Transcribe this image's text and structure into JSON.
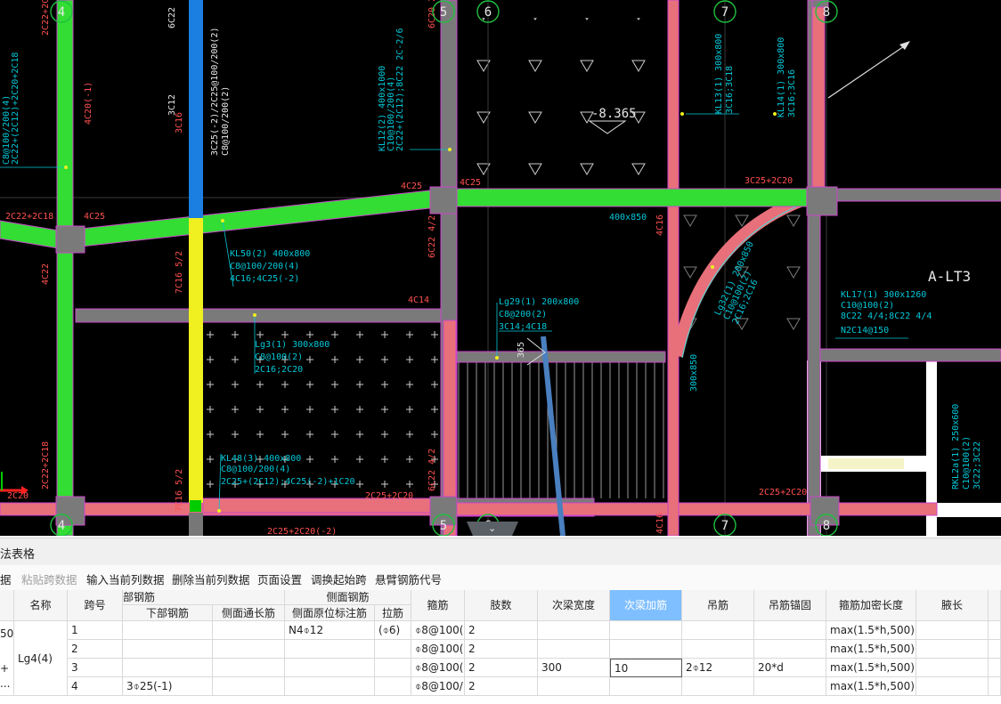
{
  "drawing": {
    "axis_labels": {
      "a4": "4",
      "a5": "5",
      "a6": "6",
      "a7": "7",
      "a8": "8"
    },
    "elevation": "-8.365",
    "region_label": "A-LT3",
    "ann": {
      "t_2c22_top": "2C22+2C18",
      "t_4c20": "4C20(-1)",
      "t_2c22_20": "2C22+(2C12)+2C20+2C18",
      "t_c8_200": "C8@100/200(4)",
      "t_3c12": "3C12",
      "t_3c16": "3C16",
      "t_6c22": "6C22",
      "t_3c25": "3C25(-2)/2C25@100/200(2)",
      "t_c8_200b": "C8@100/200(2)",
      "t_kl12": "KL12(2) 400x1000",
      "t_kl12b": "C10@100/200(4)",
      "t_kl12c": "2C22+(2C12);8C22 2C-2/6",
      "t_6c20": "6C20 2/4",
      "t_kl13": "KL13(1) 300x800",
      "t_kl13b": "3C16;3C18",
      "t_kl14": "KL14(1) 300x800",
      "t_kl14b": "3C16;3C16",
      "t_4c25a": "4C25",
      "t_4c25b": "4C25",
      "t_3c25_2c20": "3C25+2C20",
      "t_2c22_18": "2C22+2C18",
      "t_4c25c": "4C25",
      "t_400x850": "400x850",
      "t_4c16": "4C16",
      "t_4c22": "4C22",
      "t_kl50": "KL50(2) 400x800",
      "t_kl50b": "C8@100/200(4)",
      "t_kl50c": "4C16;4C25(-2)",
      "t_7c16": "7C16 5/2",
      "t_6c22_42": "6C22 4/2",
      "t_4c14": "4C14",
      "t_lg29": "Lg29(1) 200x800",
      "t_lg29b": "C8@200(2)",
      "t_lg29c": "3C14;4C18",
      "t_lg32": "Lg32(1) 200x850",
      "t_lg32b": "C10@100(2)",
      "t_lg32c": "2C16;2C16",
      "t_kl17": "KL17(1) 300x1260",
      "t_kl17b": "C10@100(2)",
      "t_kl17c": "8C22 4/4;8C22 4/4",
      "t_kl17d": "N2C14@150",
      "t_lg3": "Lg3(1) 300x800",
      "t_lg3b": "C8@100(2)",
      "t_lg3c": "2C16;2C20",
      "t_300x850": "300x850",
      "t_2c22_18b": "2C22+2C18",
      "t_kl48": "KL48(3) 400x800",
      "t_kl48b": "C8@100/200(4)",
      "t_kl48c": "2C25+(2C12);4C25(-2)+1C20",
      "t_7c16b": "7C16 5/2",
      "t_6c22_42b": "6C22 4/2",
      "t_2c25_2c20": "2C25+2C20",
      "t_2c25_2c20b": "2C25+2C20",
      "t_2c25_2c20k": "2C25+2C20(-2)",
      "t_2c20": "2C20",
      "t_rkl2": "RKL2a(1) 250x600",
      "t_rkl2b": "C10@100(2)",
      "t_rkl2c": "3C22;3C22",
      "t_365": "365",
      "t_4c16b": "4C16"
    }
  },
  "panel": {
    "title": "法表格",
    "collapse_icon": "⌄",
    "toolbar": {
      "paste_label": "据",
      "paste_span_label": "粘贴跨数据",
      "input_col_label": "输入当前列数据",
      "delete_col_label": "删除当前列数据",
      "page_setup_label": "页面设置",
      "swap_start_label": "调换起始跨",
      "cantilever_label": "悬臂钢筋代号"
    },
    "table": {
      "header": {
        "name": "名称",
        "span": "跨号",
        "bottom_group": "部钢筋",
        "bottom_bar": "下部钢筋",
        "side_group": "侧面钢筋",
        "side_through": "侧面通长筋",
        "side_orig": "侧面原位标注筋",
        "tie": "拉筋",
        "stirrup": "箍筋",
        "legs": "肢数",
        "sec_width": "次梁宽度",
        "sec_add": "次梁加筋",
        "hanger": "吊筋",
        "hanger_anchor": "吊筋锚固",
        "dense_len": "箍筋加密长度",
        "haunch_len": "腋长"
      },
      "left_fragments": {
        "f1": "50",
        "f2": "+",
        "f3": "..."
      },
      "beam_name": "Lg4(4)",
      "rows": [
        {
          "span": "1",
          "bottom": "",
          "side_through": "",
          "side_orig": "N4⌽12",
          "tie": "(⌽6)",
          "stirrup": "⌽8@100(",
          "legs": "2",
          "sec_width": "",
          "sec_add": "",
          "hanger": "",
          "anchor": "",
          "dense": "max(1.5*h,500)",
          "haunch": ""
        },
        {
          "span": "2",
          "bottom": "",
          "side_through": "",
          "side_orig": "",
          "tie": "",
          "stirrup": "⌽8@100(",
          "legs": "2",
          "sec_width": "",
          "sec_add": "",
          "hanger": "",
          "anchor": "",
          "dense": "max(1.5*h,500)",
          "haunch": ""
        },
        {
          "span": "3",
          "bottom": "",
          "side_through": "",
          "side_orig": "",
          "tie": "",
          "stirrup": "⌽8@100(",
          "legs": "2",
          "sec_width": "300",
          "sec_add": "10",
          "hanger": "2⌽12",
          "anchor": "20*d",
          "dense": "max(1.5*h,500)",
          "haunch": ""
        },
        {
          "span": "4",
          "bottom": "3⌽25(-1)",
          "side_through": "",
          "side_orig": "",
          "tie": "",
          "stirrup": "⌽8@100/",
          "legs": "2",
          "sec_width": "",
          "sec_add": "",
          "hanger": "",
          "anchor": "",
          "dense": "max(1.5*h,500)",
          "haunch": ""
        }
      ]
    }
  },
  "colors": {
    "green_beam": "#33dd33",
    "pink_beam": "#e8707a",
    "gray_beam": "#7a7a7a",
    "blue_col": "#1a7fe0",
    "yellow_col": "#f0f020",
    "cyan_text": "#00c8d8",
    "red_text": "#ff5050",
    "active_header": "#7fbfff"
  }
}
